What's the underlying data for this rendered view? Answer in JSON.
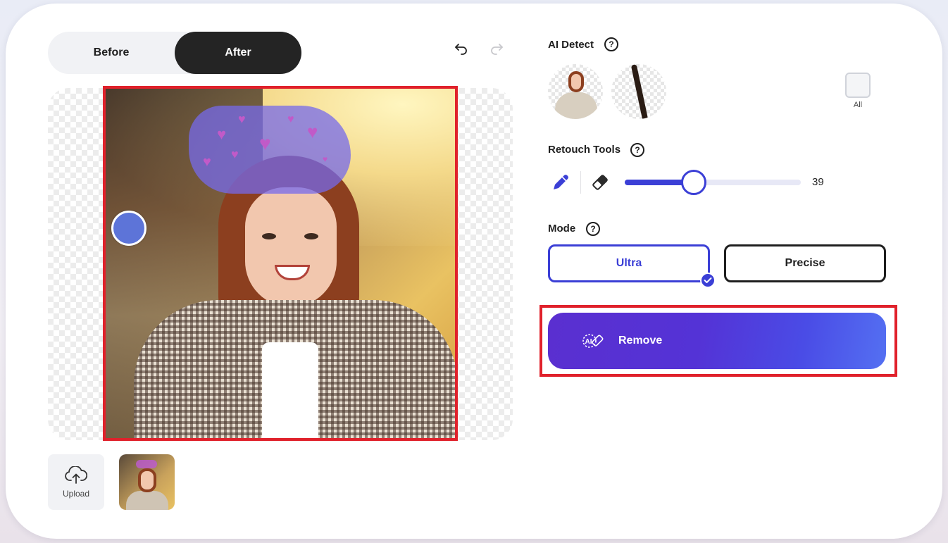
{
  "view_toggle": {
    "before_label": "Before",
    "after_label": "After",
    "active": "After"
  },
  "history": {
    "undo_icon": "undo-icon",
    "redo_icon": "redo-icon"
  },
  "bottom": {
    "upload_label": "Upload",
    "upload_icon": "cloud-upload-icon"
  },
  "ai_detect": {
    "title": "AI Detect",
    "help_label": "?",
    "items": [
      "person",
      "strap"
    ],
    "all_label": "All"
  },
  "retouch": {
    "title": "Retouch Tools",
    "help_label": "?",
    "active_tool": "brush",
    "brush_size": 39,
    "brush_size_min": 0,
    "brush_size_max": 100
  },
  "mode": {
    "title": "Mode",
    "help_label": "?",
    "options": [
      "Ultra",
      "Precise"
    ],
    "selected": "Ultra"
  },
  "action": {
    "remove_label": "Remove",
    "remove_icon": "ai-eraser-icon"
  },
  "colors": {
    "accent": "#3b3fd6",
    "dark": "#242424",
    "highlight_frame": "#e0212b",
    "mask": "#766aeb"
  }
}
